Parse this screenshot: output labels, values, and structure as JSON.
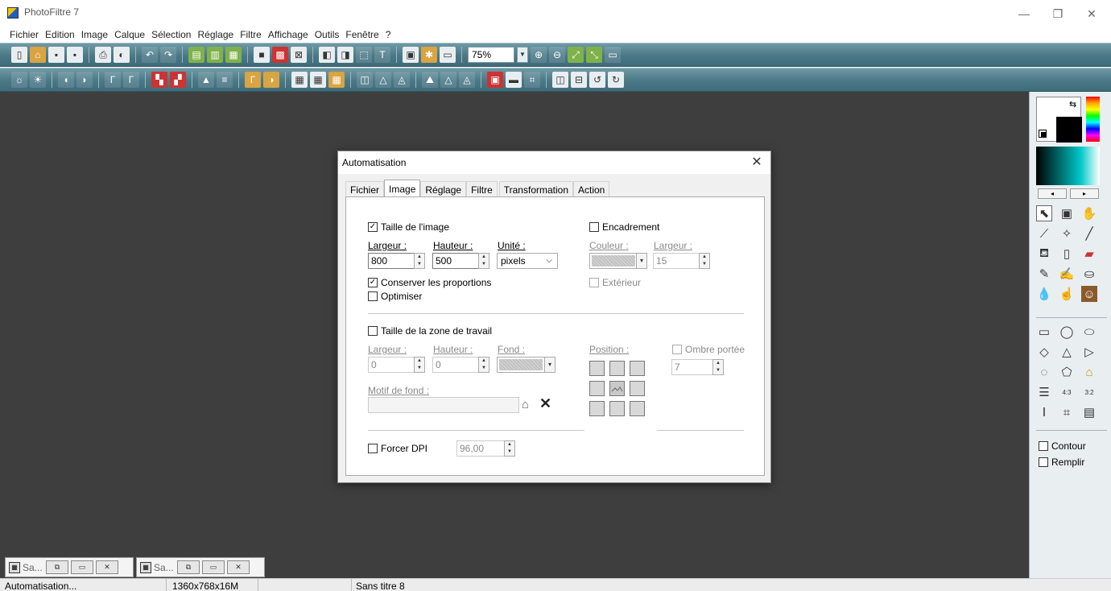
{
  "window": {
    "title": "PhotoFiltre 7",
    "minimize": "—",
    "maximize": "❐",
    "close": "✕"
  },
  "menu": [
    "Fichier",
    "Edition",
    "Image",
    "Calque",
    "Sélection",
    "Réglage",
    "Filtre",
    "Affichage",
    "Outils",
    "Fenêtre",
    "?"
  ],
  "toolbar": {
    "zoom_value": "75%"
  },
  "dialog": {
    "title": "Automatisation",
    "close": "✕",
    "tabs": [
      "Fichier",
      "Image",
      "Réglage",
      "Filtre",
      "Transformation",
      "Action"
    ],
    "active_tab": "Image",
    "taille_image": {
      "label": "Taille de l'image",
      "checked": true
    },
    "largeur_label": "Largeur :",
    "hauteur_label": "Hauteur :",
    "unite_label": "Unité :",
    "largeur_value": "800",
    "hauteur_value": "500",
    "unite_value": "pixels",
    "conserver": {
      "label": "Conserver les proportions",
      "checked": true
    },
    "optimiser": {
      "label": "Optimiser",
      "checked": false
    },
    "encadrement": {
      "label": "Encadrement",
      "checked": false
    },
    "couleur_label": "Couleur :",
    "enc_largeur_label": "Largeur :",
    "enc_largeur_value": "15",
    "exterieur": {
      "label": "Extérieur",
      "checked": false
    },
    "zone_travail": {
      "label": "Taille de la zone de travail",
      "checked": false
    },
    "zt_largeur_label": "Largeur :",
    "zt_hauteur_label": "Hauteur :",
    "zt_fond_label": "Fond :",
    "zt_largeur_value": "0",
    "zt_hauteur_value": "0",
    "position_label": "Position :",
    "ombre": {
      "label": "Ombre portée",
      "checked": false
    },
    "ombre_value": "7",
    "motif_label": "Motif de fond :",
    "motif_value": "",
    "forcer_dpi": {
      "label": "Forcer DPI",
      "checked": false
    },
    "dpi_value": "96,00"
  },
  "right_panel": {
    "contour": "Contour",
    "remplir": "Remplir"
  },
  "taskbar": [
    {
      "label": "Sa..."
    },
    {
      "label": "Sa..."
    }
  ],
  "status": {
    "left": "Automatisation...",
    "size": "1360x768x16M",
    "doc": "Sans titre 8"
  }
}
